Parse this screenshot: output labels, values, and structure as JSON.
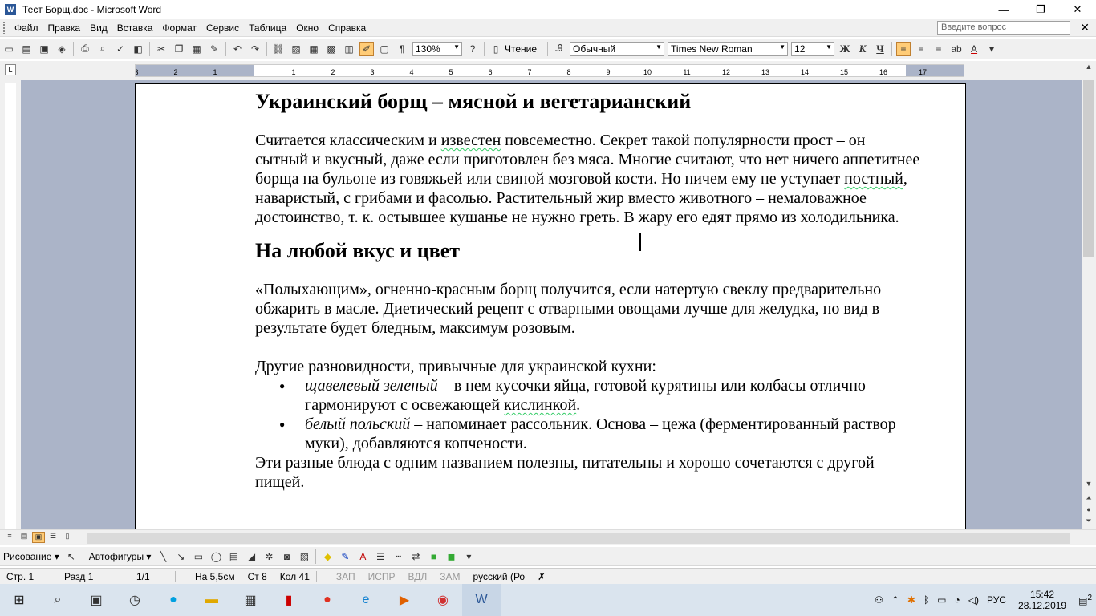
{
  "window": {
    "title": "Тест Борщ.doc - Microsoft Word",
    "icon_letter": "W",
    "controls": [
      "—",
      "❐",
      "✕"
    ]
  },
  "menu": {
    "items": [
      "Файл",
      "Правка",
      "Вид",
      "Вставка",
      "Формат",
      "Сервис",
      "Таблица",
      "Окно",
      "Справка"
    ],
    "ask_placeholder": "Введите вопрос",
    "close_glyph": "✕"
  },
  "toolbar": {
    "zoom": "130%",
    "reading_label": "Чтение",
    "style": "Обычный",
    "font": "Times New Roman",
    "size": "12",
    "bold": "Ж",
    "italic": "К",
    "underline": "Ч"
  },
  "document": {
    "heading1": "Украинский борщ – мясной и вегетарианский",
    "para1": {
      "p1": "Считается классическим и ",
      "w1": "известен",
      "p2": " повсеместно. Секрет такой популярности прост – он сытный и вкусный, даже если приготовлен без мяса. Многие считают, что нет ничего аппетитнее борща на бульоне из говяжьей или свиной мозговой кости. Но ничем ему не уступает ",
      "w2": "постный",
      "p3": ", наваристый, с грибами и фасолью. Растительный жир вместо животного – немаловажное достоинство, т. к. остывшее кушанье не нужно греть. В жару его едят прямо из холодильника."
    },
    "heading2": "На любой вкус и цвет",
    "para2": "«Полыхающим», огненно-красным борщ получится, если натертую свеклу предварительно обжарить в масле. Диетический рецепт с отварными овощами лучше для желудка, но вид в результате будет бледным, максимум розовым.",
    "para3": "Другие разновидности, привычные для украинской кухни:",
    "bullets": [
      {
        "italic": "щавелевый зеленый",
        "text": " – в нем кусочки яйца, готовой курятины или колбасы отлично гармонируют с освежающей ",
        "squig": "кислинкой",
        "tail": "."
      },
      {
        "italic": "белый польский",
        "text": " – напоминает рассольник. Основа – цежа (ферментированный раствор муки), добавляются копчености.",
        "squig": "",
        "tail": ""
      }
    ],
    "para4": "Эти разные блюда с одним названием полезны, питательны и хорошо сочетаются с другой пищей."
  },
  "drawing": {
    "draw_label": "Рисование",
    "autoshapes_label": "Автофигуры"
  },
  "status": {
    "page": "Стр. 1",
    "section": "Разд 1",
    "pages": "1/1",
    "at": "На 5,5см",
    "line": "Ст 8",
    "col": "Кол 41",
    "rec": "ЗАП",
    "trk": "ИСПР",
    "ext": "ВДЛ",
    "ovr": "ЗАМ",
    "lang": "русский (Ро"
  },
  "taskbar": {
    "lang": "РУС",
    "time": "15:42",
    "date": "28.12.2019",
    "notif_count": "2"
  },
  "ruler": {
    "numbers": [
      "3",
      "2",
      "1",
      "1",
      "2",
      "3",
      "4",
      "5",
      "6",
      "7",
      "8",
      "9",
      "10",
      "11",
      "12",
      "13",
      "14",
      "15",
      "16",
      "17"
    ]
  }
}
